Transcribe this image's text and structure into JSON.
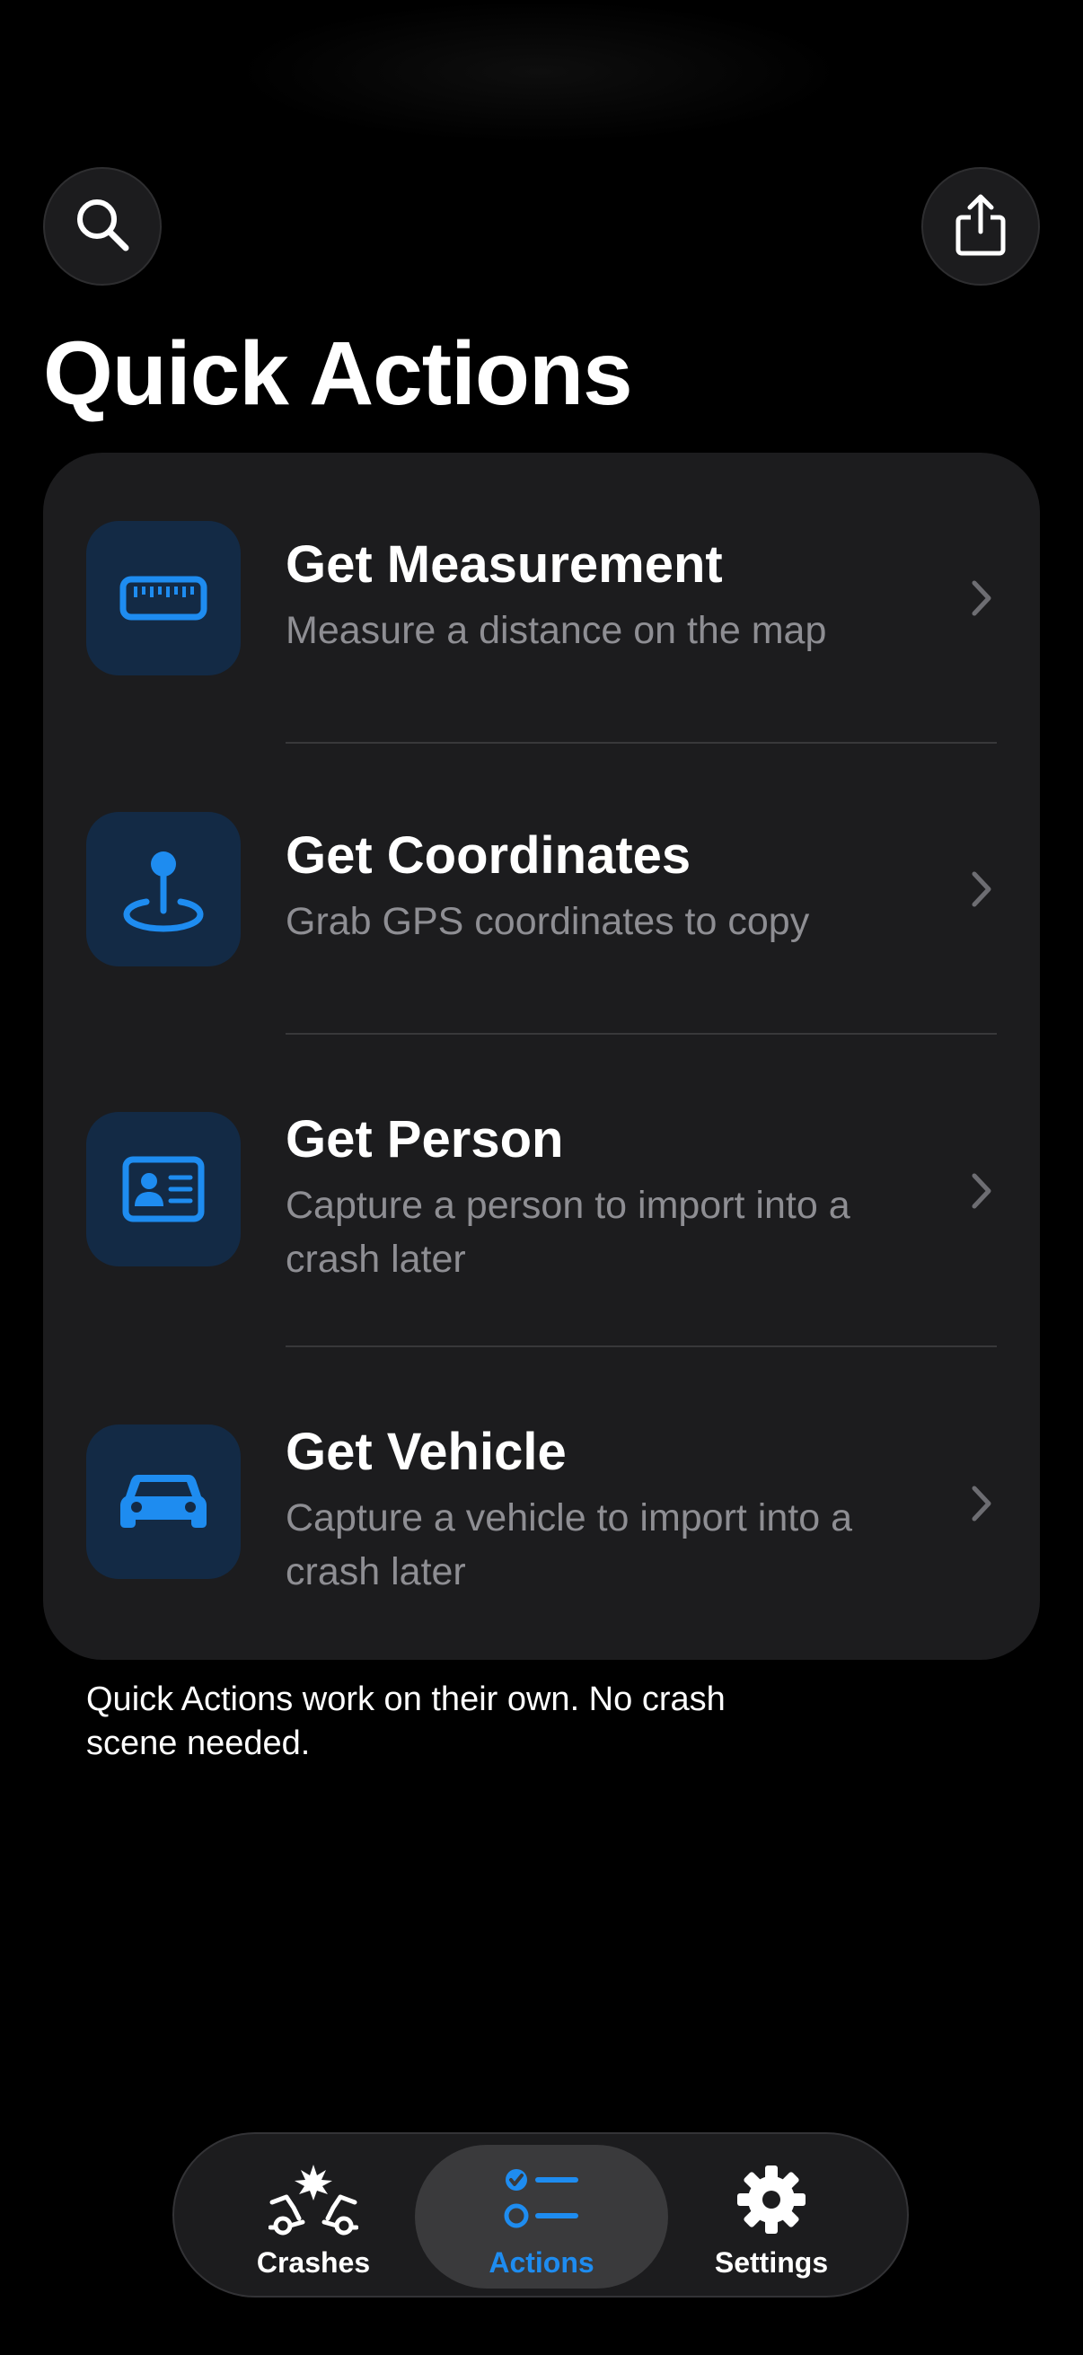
{
  "header": {
    "search_icon": "search-icon",
    "share_icon": "share-icon",
    "title": "Quick Actions"
  },
  "actions": [
    {
      "title": "Get Measurement",
      "subtitle": "Measure a distance on the map",
      "icon": "ruler-icon"
    },
    {
      "title": "Get Coordinates",
      "subtitle": "Grab GPS coordinates to copy",
      "icon": "map-pin-icon"
    },
    {
      "title": "Get Person",
      "subtitle": "Capture a person to import into a crash later",
      "icon": "id-card-icon"
    },
    {
      "title": "Get Vehicle",
      "subtitle": "Capture a vehicle to import into a crash later",
      "icon": "car-icon"
    }
  ],
  "footnote": "Quick Actions work on their own. No crash scene needed.",
  "tabbar": {
    "tabs": [
      {
        "label": "Crashes",
        "icon": "car-crash-icon",
        "active": false
      },
      {
        "label": "Actions",
        "icon": "checklist-icon",
        "active": true
      },
      {
        "label": "Settings",
        "icon": "gear-icon",
        "active": false
      }
    ]
  },
  "colors": {
    "accent": "#1e8cf0",
    "background": "#000000",
    "card": "#1c1c1e",
    "icon_tile": "#132a45",
    "secondary_text": "#8e8e93"
  }
}
